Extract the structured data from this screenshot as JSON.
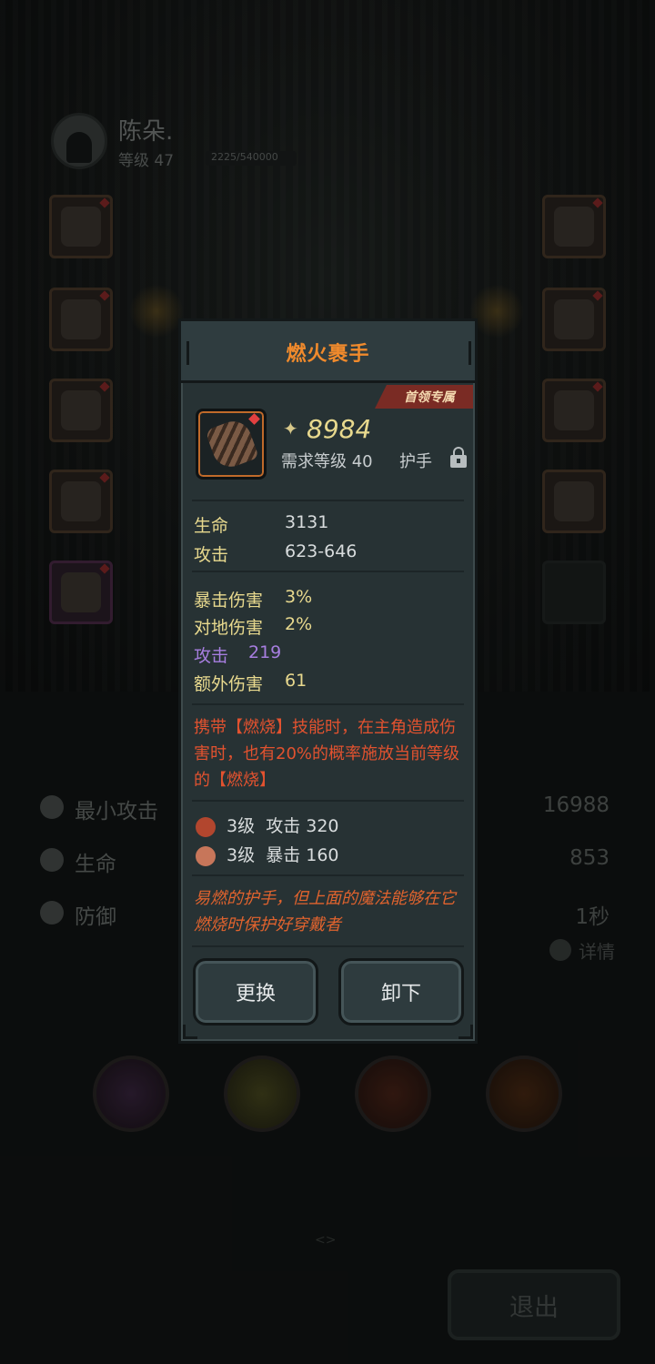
{
  "player": {
    "name": "陈朵.",
    "level": "等级 47",
    "xp": "2225/540000"
  },
  "stats": [
    {
      "label": "最小攻击",
      "value": "16988"
    },
    {
      "label": "生命",
      "value": "853"
    },
    {
      "label": "防御",
      "value": "1秒"
    }
  ],
  "detail_label": "详情",
  "exit_label": "退出",
  "page_indicator": "<>",
  "item": {
    "name": "燃火裹手",
    "tag": "首领专属",
    "power": "8984",
    "required_level": "需求等级 40",
    "slot_type": "护手",
    "base_stats": [
      {
        "label": "生命",
        "value": "3131"
      },
      {
        "label": "攻击",
        "value": "623-646"
      }
    ],
    "extra_stats": [
      {
        "label": "暴击伤害",
        "value": "3%",
        "color": "#e8d98e"
      },
      {
        "label": "对地伤害",
        "value": "2%",
        "color": "#e8d98e"
      },
      {
        "label": "攻击",
        "value": "219",
        "color": "#a77ee0"
      },
      {
        "label": "额外伤害",
        "value": "61",
        "color": "#e8d98e"
      }
    ],
    "effect": "携带【燃烧】技能时，在主角造成伤害时，也有20%的概率施放当前等级的【燃烧】",
    "gems": [
      {
        "level": "3级",
        "stat": "攻击 320",
        "color": "#b2462e"
      },
      {
        "level": "3级",
        "stat": "暴击 160",
        "color": "#c7765a"
      }
    ],
    "flavor": "易燃的护手，但上面的魔法能够在它燃烧时保护好穿戴者",
    "buttons": {
      "replace": "更换",
      "unequip": "卸下"
    }
  },
  "colors": {
    "title": "#f08a2c",
    "stat_label": "#e8d98e",
    "purple_stat": "#a77ee0",
    "effect_text": "#e2522f",
    "modal_bg": "#273234"
  }
}
